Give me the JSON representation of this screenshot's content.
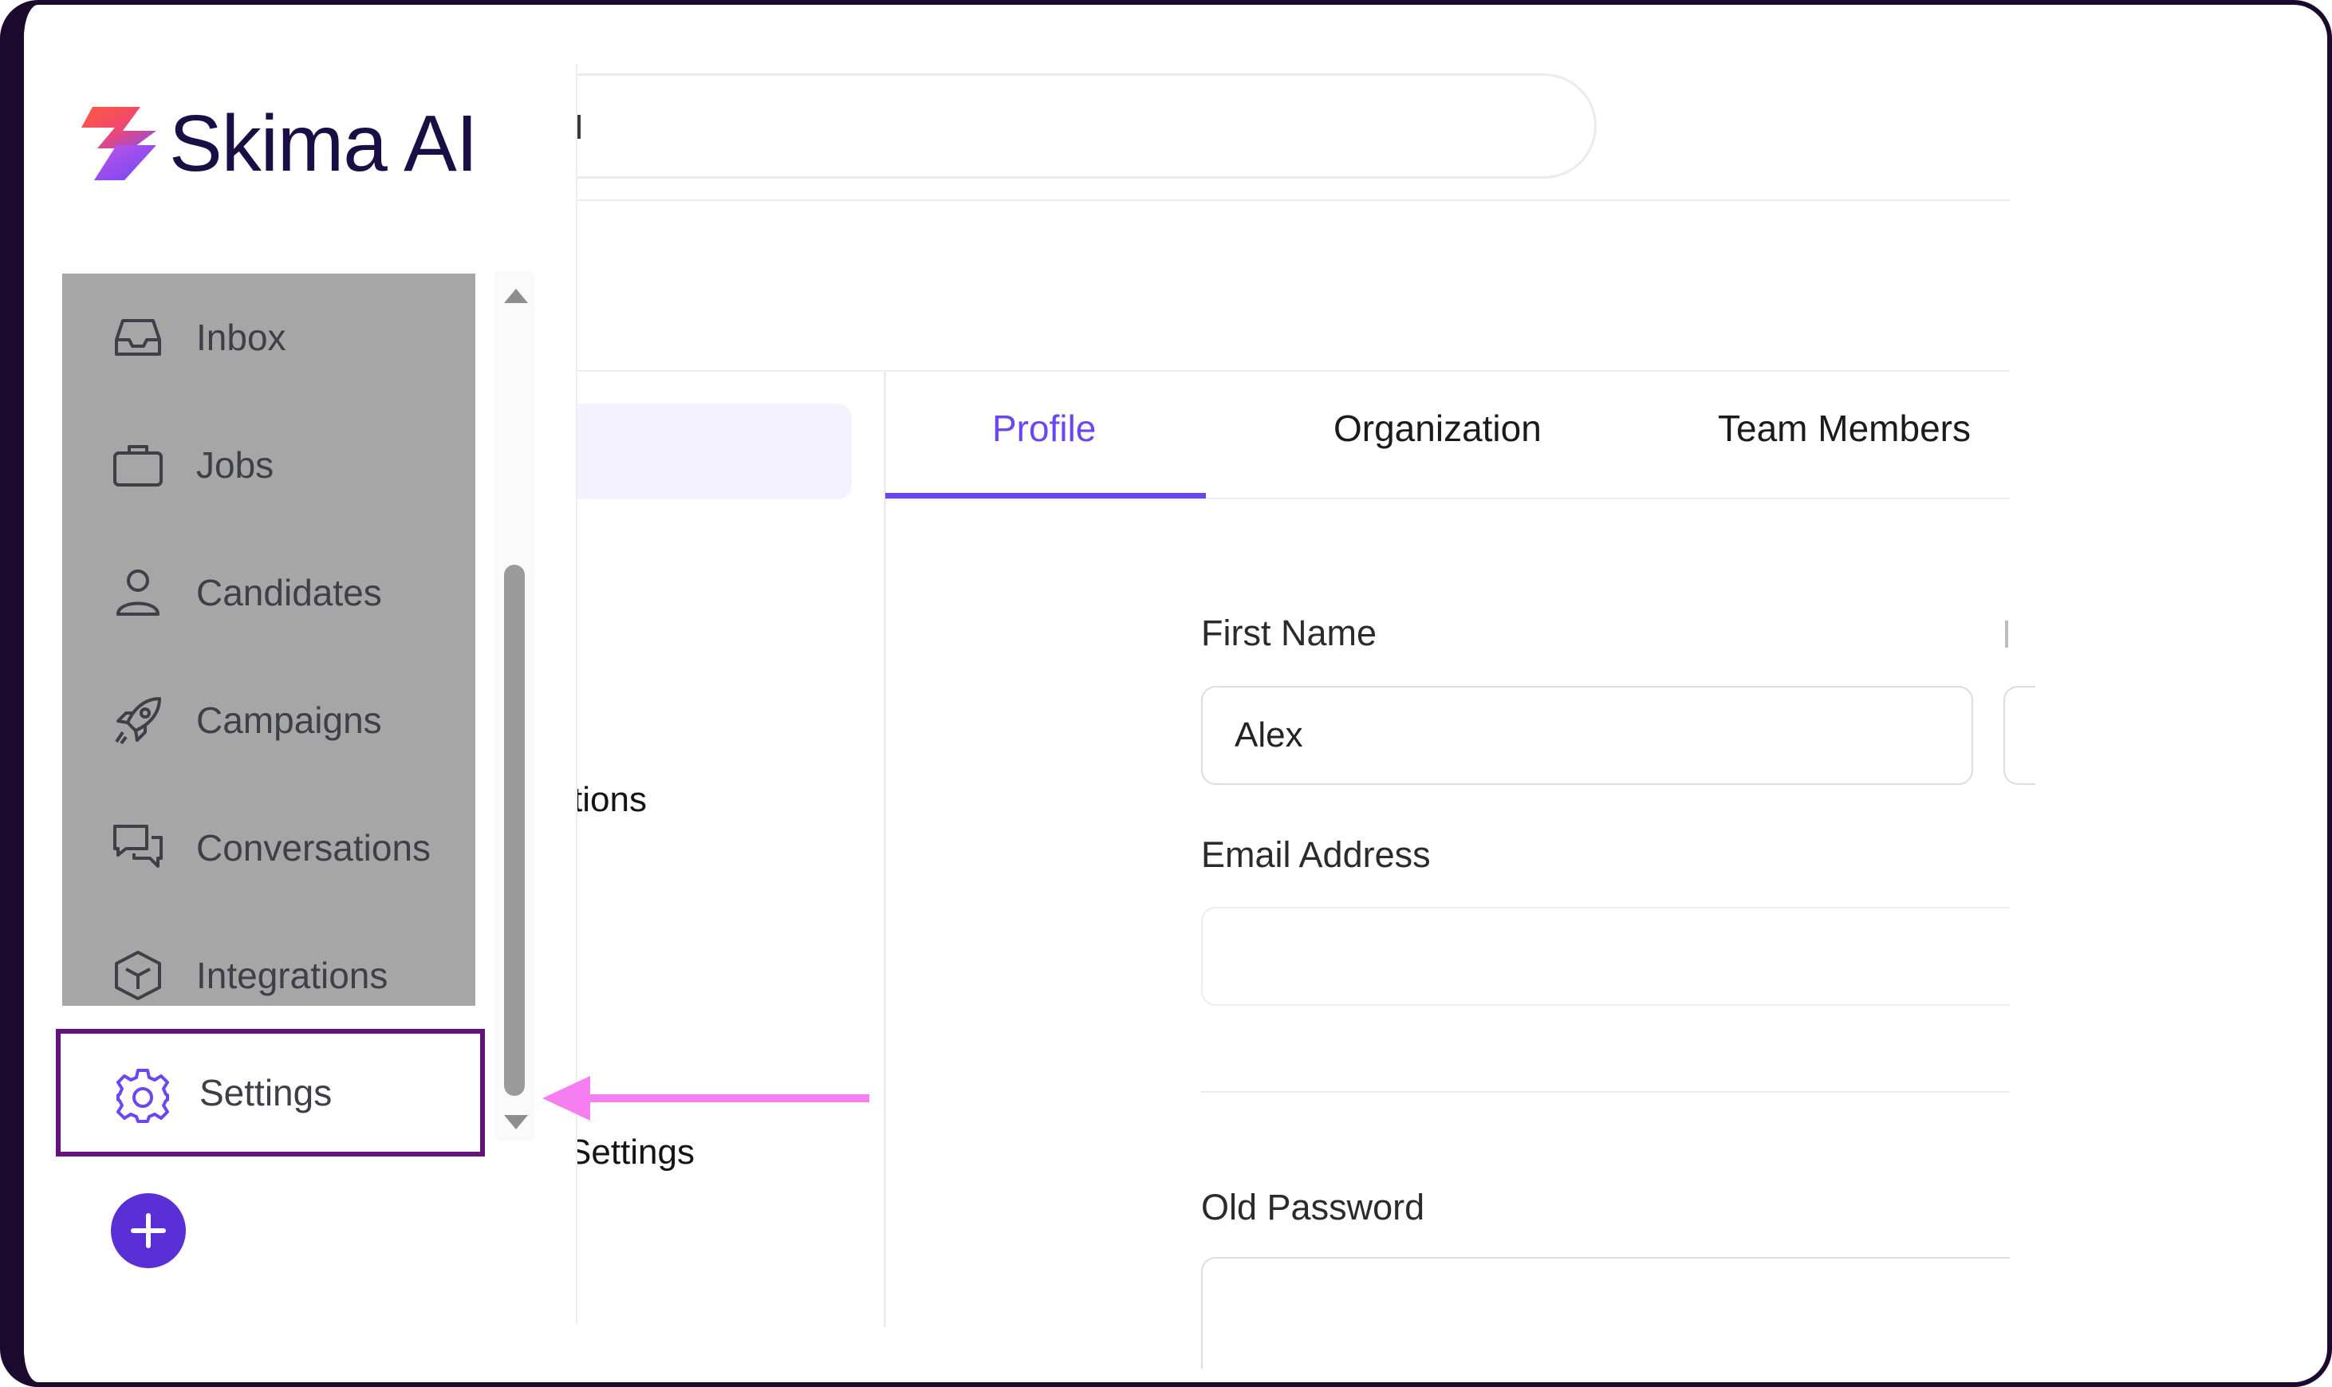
{
  "app": {
    "brand_name": "Skima AI"
  },
  "sidebar": {
    "items": [
      {
        "label": "Inbox",
        "icon": "inbox-icon"
      },
      {
        "label": "Jobs",
        "icon": "briefcase-icon"
      },
      {
        "label": "Candidates",
        "icon": "user-icon"
      },
      {
        "label": "Campaigns",
        "icon": "rocket-icon"
      },
      {
        "label": "Conversations",
        "icon": "chat-bubbles-icon"
      },
      {
        "label": "Integrations",
        "icon": "cube-icon"
      }
    ],
    "settings": {
      "label": "Settings",
      "icon": "gear-icon"
    },
    "add_button": {
      "icon": "plus-icon"
    }
  },
  "settings_menu": {
    "partial_item_1": "tions",
    "partial_item_2": "Settings"
  },
  "tabs": [
    {
      "label": "Profile",
      "active": true
    },
    {
      "label": "Organization",
      "active": false
    },
    {
      "label": "Team Members",
      "active": false
    }
  ],
  "form": {
    "first_name": {
      "label": "First Name",
      "value": "Alex"
    },
    "email": {
      "label": "Email Address",
      "value": ""
    },
    "old_password": {
      "label": "Old Password",
      "value": ""
    }
  },
  "colors": {
    "accent": "#6b46f2",
    "brand_dark": "#1a0f44",
    "highlight_border": "#64137a",
    "annotation_arrow": "#f57ff0",
    "add_button": "#5a2fd6"
  }
}
